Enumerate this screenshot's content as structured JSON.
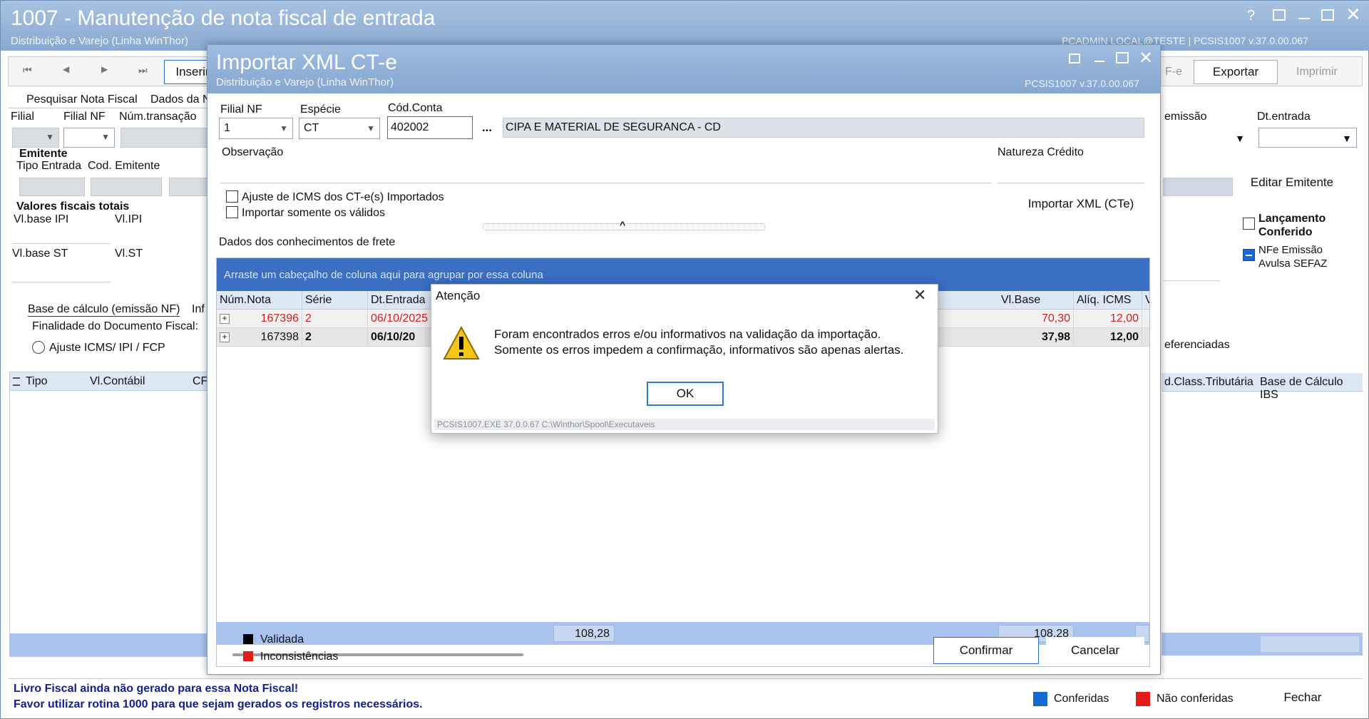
{
  "main_window": {
    "title": "1007 - Manutenção de nota fiscal de entrada",
    "subtitle": "Distribuição e Varejo (Linha WinThor)",
    "version": "PCADMIN LOCAL@TESTE | PCSIS1007 v.37.0.00.067",
    "toolbar": {
      "first": "⏮",
      "prev": "◀",
      "next": "▶",
      "last": "⏭",
      "insert": "Inserir",
      "nfe_fragment": "F-e",
      "exportar": "Exportar",
      "imprimir": "Imprimir"
    },
    "tabs": [
      "Pesquisar Nota Fiscal",
      "Dados da N"
    ],
    "labels": {
      "filial": "Filial",
      "filial_nf": "Filial NF",
      "num_transacao": "Núm.transação",
      "emitente": "Emitente",
      "tipo_entrada": "Tipo Entrada",
      "cod_emitente": "Cod. Emitente",
      "valores_fiscais": "Valores fiscais totais",
      "vl_base_ipi": "Vl.base IPI",
      "vl_ipi": "Vl.IPI",
      "vl_base_st": "Vl.base ST",
      "vl_st": "Vl.ST",
      "emissao": "emissão",
      "dt_entrada": "Dt.entrada"
    },
    "bottom_tabs": [
      "Base de cálculo (emissão NF)",
      "Inf"
    ],
    "finalidade": "Finalidade do Documento Fiscal:",
    "ajuste_radio": "Ajuste ICMS/ IPI / FCP",
    "grid_cols": [
      "Tipo",
      "Vl.Contábil",
      "CF"
    ],
    "right": {
      "editar_emitente": "Editar Emitente",
      "lancamento_conferido": "Lançamento Conferido",
      "nfe_emissao": "NFe Emissão Avulsa SEFAZ",
      "referenciadas": "eferenciadas",
      "col_class": "d.Class.Tributária",
      "col_base_ibs": "Base de Cálculo IBS"
    },
    "status_line1": "Livro Fiscal ainda não gerado para essa Nota Fiscal!",
    "status_line2": "Favor utilizar rotina 1000 para que sejam gerados os registros necessários.",
    "legend_conferidas": "Conferidas",
    "legend_nao_conferidas": "Não conferidas",
    "fechar": "Fechar"
  },
  "import_dialog": {
    "title": "Importar XML CT-e",
    "subtitle": "Distribuição e Varejo (Linha WinThor)",
    "version": "PCSIS1007 v.37.0.00.067",
    "filial_nf_label": "Filial NF",
    "filial_nf_value": "1",
    "especie_label": "Espécie",
    "especie_value": "CT",
    "cod_conta_label": "Cód.Conta",
    "cod_conta_value": "402002",
    "ellipsis": "...",
    "conta_desc": "CIPA E MATERIAL DE SEGURANCA - CD",
    "observacao_label": "Observação",
    "natureza_label": "Natureza Crédito",
    "chk_ajuste": "Ajuste de ICMS dos CT-e(s) Importados",
    "chk_validos": "Importar somente os válidos",
    "importar_btn": "Importar XML (CTe)",
    "grid_title": "Dados dos conhecimentos de frete",
    "group_hint": "Arraste um cabeçalho de coluna aqui para agrupar por essa coluna",
    "columns": [
      "Núm.Nota",
      "Série",
      "Dt.Entrada",
      "Vl.Base",
      "Alíq. ICMS",
      "Vl. I"
    ],
    "rows": [
      {
        "expander": "+",
        "num": "167396",
        "serie": "2",
        "dt": "06/10/2025",
        "vlbase": "70,30",
        "aliq": "12,00"
      },
      {
        "expander": "+",
        "num": "167398",
        "serie": "2",
        "dt": "06/10/20",
        "vlbase": "37,98",
        "aliq": "12,00"
      }
    ],
    "total_left": "108,28",
    "total_right": "108,28",
    "legend_validada": "Validada",
    "legend_inconsistencias": "Inconsistências",
    "confirmar": "Confirmar",
    "cancelar": "Cancelar"
  },
  "alert": {
    "title": "Atenção",
    "line1": "Foram encontrados erros e/ou informativos na validação da importação.",
    "line2": "Somente os erros impedem a confirmação, informativos são apenas alertas.",
    "ok": "OK",
    "footer": "PCSIS1007.EXE 37.0.0.67 C:\\Winthor\\Spool\\Executaveis"
  },
  "colors": {
    "title_bar": "#8fb0d6",
    "grid_blue": "#3a6fc4",
    "total_blue": "#a9c3ee",
    "conferidas": "#1769d1",
    "nao_conferidas": "#e41b1b",
    "status_blue": "#12208f"
  }
}
